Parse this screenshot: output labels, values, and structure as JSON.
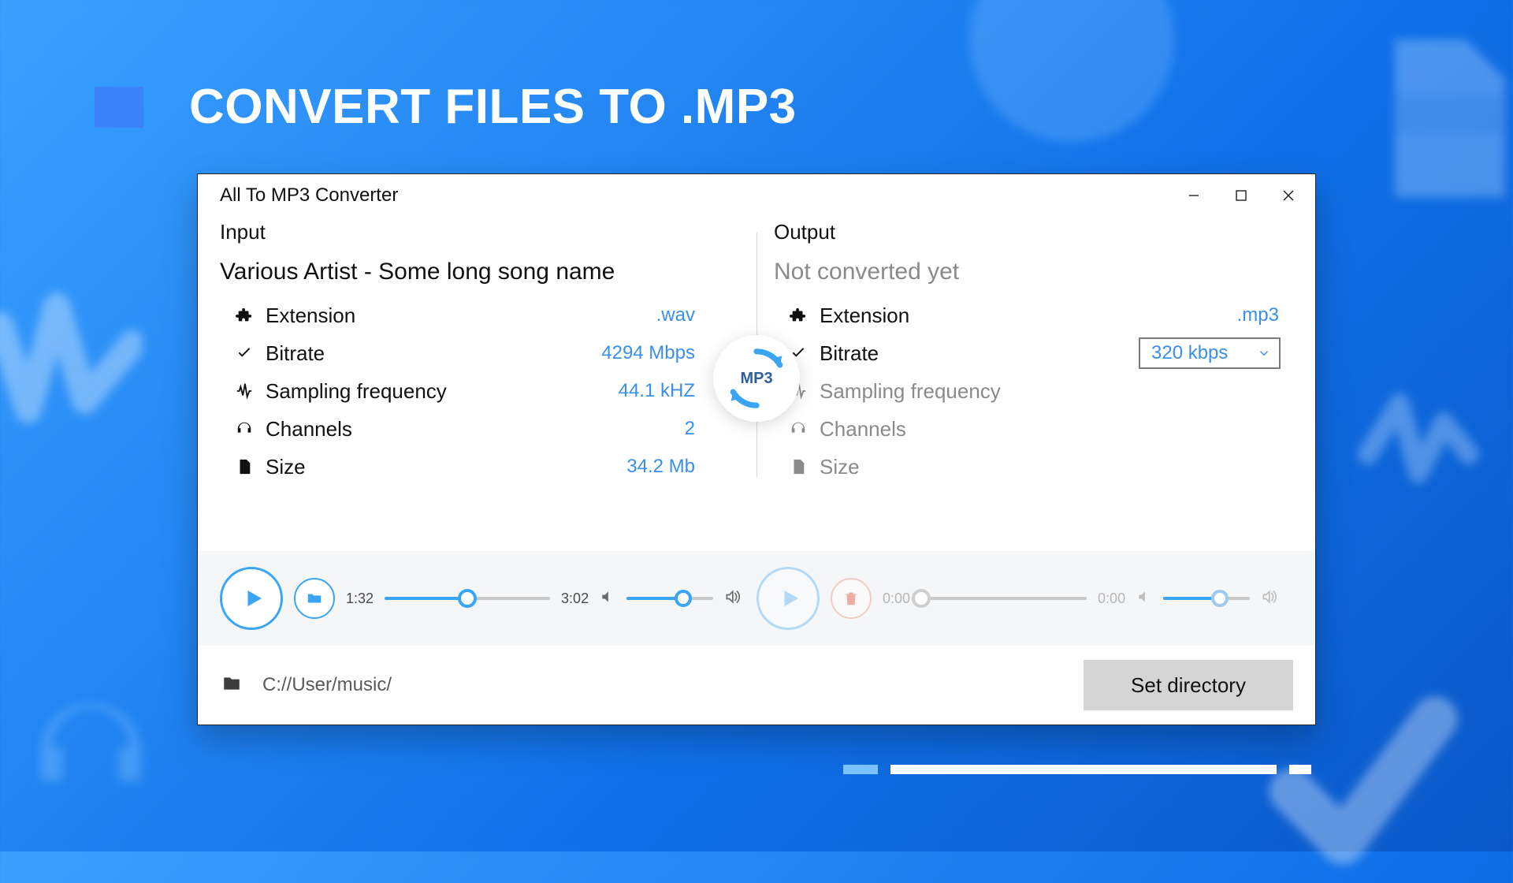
{
  "promo": {
    "title": "CONVERT FILES TO .MP3"
  },
  "window": {
    "title": "All To MP3 Converter"
  },
  "center_badge": "MP3",
  "input": {
    "heading": "Input",
    "file_title": "Various Artist - Some long song name",
    "props": {
      "extension": {
        "label": "Extension",
        "value": ".wav"
      },
      "bitrate": {
        "label": "Bitrate",
        "value": "4294 Mbps"
      },
      "sampling": {
        "label": "Sampling frequency",
        "value": "44.1 kHZ"
      },
      "channels": {
        "label": "Channels",
        "value": "2"
      },
      "size": {
        "label": "Size",
        "value": "34.2 Mb"
      }
    },
    "player": {
      "current": "1:32",
      "total": "3:02",
      "progress_pct": 50,
      "volume_pct": 65
    }
  },
  "output": {
    "heading": "Output",
    "file_title": "Not converted yet",
    "props": {
      "extension": {
        "label": "Extension",
        "value": ".mp3"
      },
      "bitrate": {
        "label": "Bitrate",
        "value": "320 kbps"
      },
      "sampling": {
        "label": "Sampling frequency",
        "value": ""
      },
      "channels": {
        "label": "Channels",
        "value": ""
      },
      "size": {
        "label": "Size",
        "value": ""
      }
    },
    "player": {
      "current": "0:00",
      "total": "0:00",
      "progress_pct": 0,
      "volume_pct": 65
    }
  },
  "footer": {
    "path": "C://User/music/",
    "set_directory_label": "Set directory"
  }
}
